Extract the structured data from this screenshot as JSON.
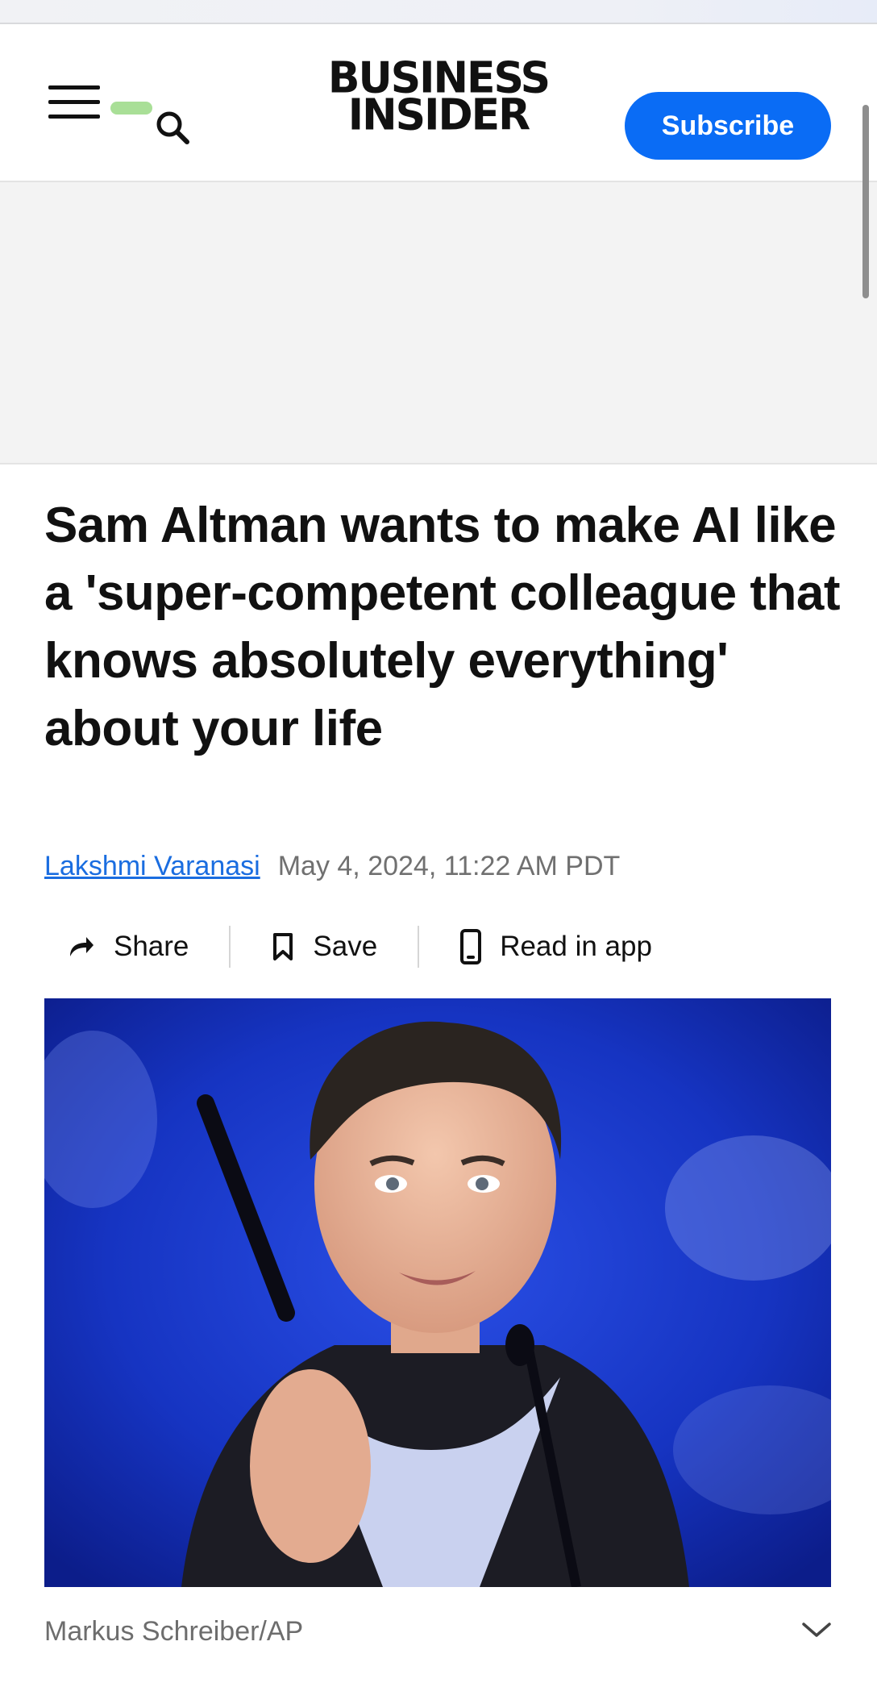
{
  "header": {
    "logo_line1": "BUSINESS",
    "logo_line2": "INSIDER",
    "subscribe_label": "Subscribe",
    "icons": [
      "menu-icon",
      "search-icon"
    ]
  },
  "article": {
    "headline": "Sam Altman wants to make AI like a 'super-competent colleague that knows absolutely everything' about your life",
    "author": "Lakshmi Varanasi",
    "date": "May 4, 2024, 11:22 AM PDT",
    "actions": {
      "share": "Share",
      "save": "Save",
      "read_in_app": "Read in app"
    },
    "photo_credit": "Markus Schreiber/AP"
  },
  "colors": {
    "accent": "#0a6cf5",
    "link": "#1a6de0",
    "photo_background": "#1a35c8"
  }
}
